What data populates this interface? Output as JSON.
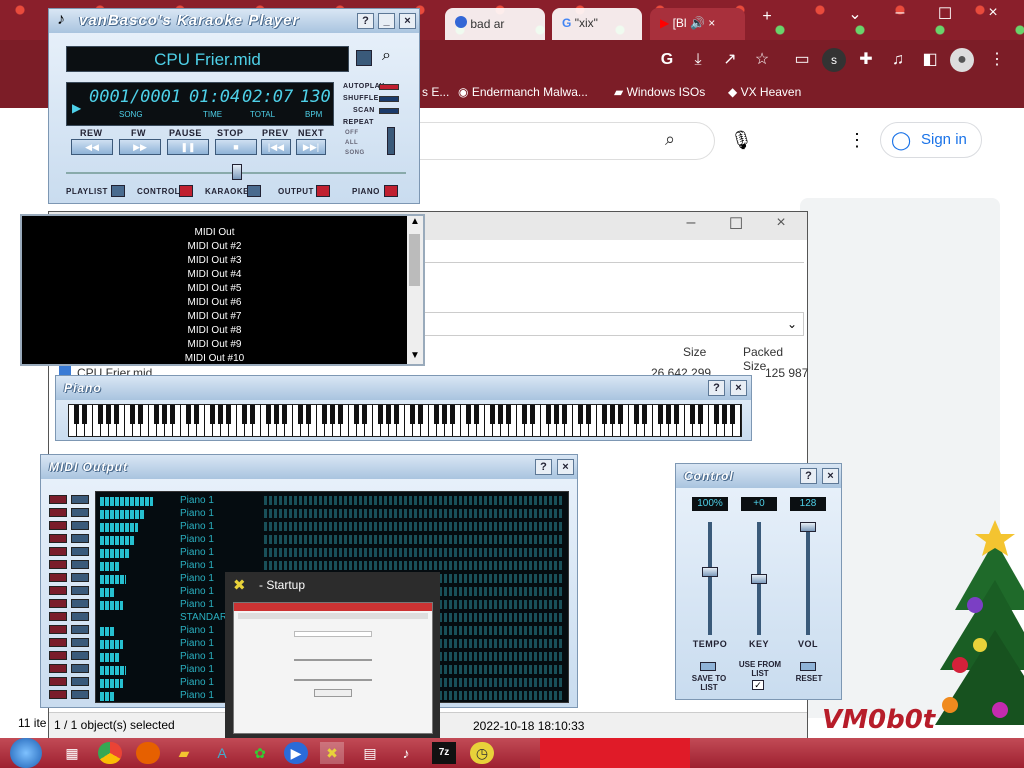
{
  "browser": {
    "tabs": [
      {
        "label": "bad ar",
        "color": "#3367d6"
      },
      {
        "label": "\"xix\"",
        "color": "#4285f4"
      },
      {
        "label": "[Bl",
        "color": "#ff0000"
      }
    ],
    "bookmarks": [
      "s E...",
      "Endermanch Malwa...",
      "Windows ISOs",
      "VX Heaven"
    ],
    "sign_in": "Sign in",
    "toolbar_icons": [
      "google-icon",
      "install-icon",
      "share-icon",
      "star-icon",
      "flag-icon",
      "extension-s-icon",
      "puzzle-icon",
      "media-icon",
      "sidepanel-icon",
      "profile-icon",
      "menu-icon"
    ]
  },
  "vanbasco": {
    "title": "vanBasco's Karaoke Player",
    "song": "CPU Frier.mid",
    "song_pos": "0001/0001",
    "time": "01:04",
    "total": "02:07",
    "bpm": "130",
    "lbl_song": "SONG",
    "lbl_time": "TIME",
    "lbl_total": "TOTAL",
    "lbl_bpm": "BPM",
    "options": [
      "AUTOPLAY",
      "SHUFFLE",
      "SCAN",
      "REPEAT"
    ],
    "repeat_modes": [
      "OFF",
      "ALL",
      "SONG"
    ],
    "transport": [
      "REW",
      "FW",
      "PAUSE",
      "STOP",
      "PREV",
      "NEXT"
    ],
    "panes": [
      "PLAYLIST",
      "CONTROL",
      "KARAOKE",
      "OUTPUT",
      "PIANO"
    ],
    "help": "?",
    "min": "_",
    "close": "×"
  },
  "midi_out_list": [
    "MIDI Out",
    "MIDI Out #2",
    "MIDI Out #3",
    "MIDI Out #4",
    "MIDI Out #5",
    "MIDI Out #6",
    "MIDI Out #7",
    "MIDI Out #8",
    "MIDI Out #9",
    "MIDI Out #10"
  ],
  "zip": {
    "headers": {
      "size": "Size",
      "packed": "Packed Size"
    },
    "file": {
      "name": "CPU Frier.mid",
      "size": "26 642 299",
      "packed": "125 987"
    },
    "status_left": "11 ite",
    "status_sel": "1 / 1 object(s) selected",
    "status_date": "2022-10-18 18:10:33"
  },
  "piano": {
    "title": "Piano",
    "help": "?",
    "close": "×"
  },
  "midi_output": {
    "title": "MIDI Output",
    "help": "?",
    "close": "×",
    "channels": [
      {
        "name": "Piano 1",
        "level": 0.7
      },
      {
        "name": "Piano 1",
        "level": 0.6
      },
      {
        "name": "Piano 1",
        "level": 0.5
      },
      {
        "name": "Piano 1",
        "level": 0.45
      },
      {
        "name": "Piano 1",
        "level": 0.4
      },
      {
        "name": "Piano 1",
        "level": 0.25
      },
      {
        "name": "Piano 1",
        "level": 0.35
      },
      {
        "name": "Piano 1",
        "level": 0.2
      },
      {
        "name": "Piano 1",
        "level": 0.3
      },
      {
        "name": "STANDARD",
        "level": 0.0
      },
      {
        "name": "Piano 1",
        "level": 0.2
      },
      {
        "name": "Piano 1",
        "level": 0.3
      },
      {
        "name": "Piano 1",
        "level": 0.25
      },
      {
        "name": "Piano 1",
        "level": 0.35
      },
      {
        "name": "Piano 1",
        "level": 0.3
      },
      {
        "name": "Piano 1",
        "level": 0.2
      }
    ]
  },
  "control": {
    "title": "Control",
    "help": "?",
    "close": "×",
    "tempo": {
      "label": "TEMPO",
      "value": "100%",
      "level": 0.56
    },
    "key": {
      "label": "KEY",
      "value": "+0",
      "level": 0.5
    },
    "vol": {
      "label": "VOL",
      "value": "128",
      "level": 1.0
    },
    "save": "SAVE TO LIST",
    "use": "USE FROM LIST",
    "reset": "RESET"
  },
  "startup": {
    "title": "- Startup"
  },
  "desktop": {
    "logo": "VM0b0t"
  },
  "colors": {
    "lcd": "#4ed0e8",
    "skin": "#c9dcef",
    "chrome": "#7c1d27"
  }
}
